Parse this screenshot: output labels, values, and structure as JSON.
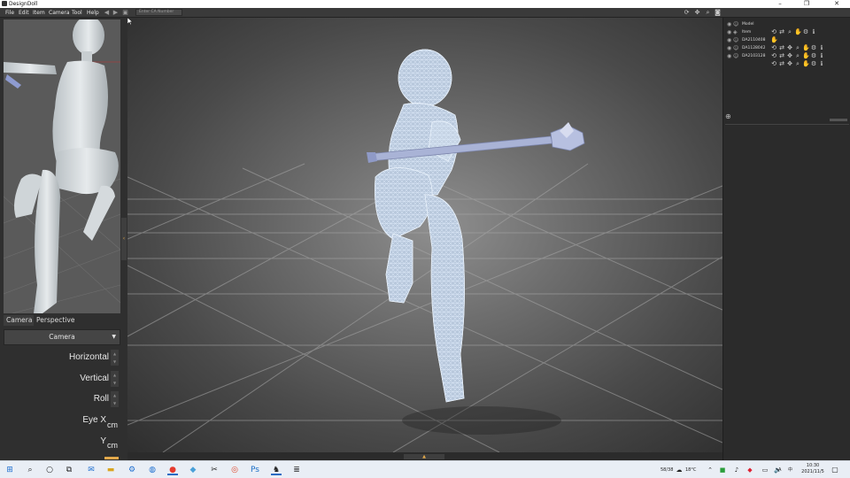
{
  "window": {
    "title": "DesignDoll",
    "minimize_glyph": "–",
    "maximize_glyph": "❐",
    "close_glyph": "✕"
  },
  "menu": {
    "items": [
      "File",
      "Edit",
      "Item",
      "Camera",
      "Tool",
      "Help"
    ],
    "search_placeholder": "Enter CA Number"
  },
  "left_panel": {
    "tabs": [
      "Camera",
      "Perspective"
    ],
    "camera_dropdown": "Camera",
    "params": [
      "Horizontal",
      "Vertical",
      "Roll",
      "Eye X",
      "Y"
    ],
    "unit": "cm"
  },
  "scene_list": {
    "rows": [
      {
        "name": "Model",
        "icon": "person-icon"
      },
      {
        "name": "Item",
        "icon": "item-icon"
      },
      {
        "name": "DA2110408",
        "icon": "person-icon"
      },
      {
        "name": "DA1128042",
        "icon": "person-icon"
      },
      {
        "name": "DA2103128",
        "icon": "person-icon"
      }
    ]
  },
  "taskbar": {
    "weather": "18°C",
    "ime_a": "A",
    "ime_ch": "中",
    "tray_label": "58/38",
    "time": "10:30",
    "date": "2021/11/5"
  },
  "colors": {
    "accent": "#e2a84a",
    "mesh": "#cfe0f5",
    "panel": "#2f2f2f",
    "staff": "#a9b3d6"
  }
}
